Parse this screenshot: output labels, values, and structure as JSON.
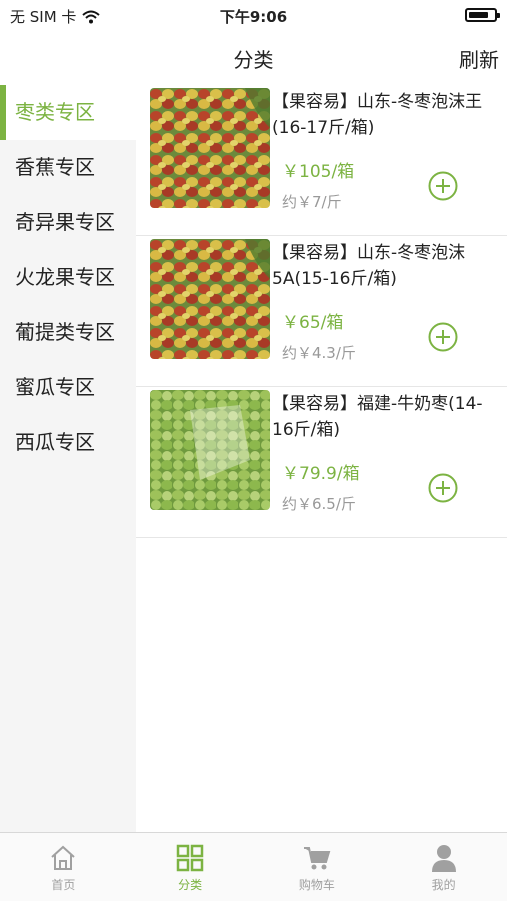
{
  "status_bar": {
    "carrier": "无 SIM 卡",
    "time": "下午9:06",
    "battery_level": 0.8
  },
  "nav": {
    "title": "分类",
    "refresh_label": "刷新"
  },
  "sidebar": {
    "items": [
      {
        "label": "枣类专区",
        "active": true
      },
      {
        "label": "香蕉专区",
        "active": false
      },
      {
        "label": "奇异果专区",
        "active": false
      },
      {
        "label": "火龙果专区",
        "active": false
      },
      {
        "label": "葡提类专区",
        "active": false
      },
      {
        "label": "蜜瓜专区",
        "active": false
      },
      {
        "label": "西瓜专区",
        "active": false
      }
    ]
  },
  "products": [
    {
      "name": "【果容易】山东-冬枣泡沫王(16-17斤/箱)",
      "price": "￥105/箱",
      "unit_price": "约￥7/斤",
      "image": "dates-red-green"
    },
    {
      "name": "【果容易】山东-冬枣泡沫5A(15-16斤/箱)",
      "price": "￥65/箱",
      "unit_price": "约￥4.3/斤",
      "image": "dates-red-green"
    },
    {
      "name": "【果容易】福建-牛奶枣(14-16斤/箱)",
      "price": "￥79.9/箱",
      "unit_price": "约￥6.5/斤",
      "image": "dates-green"
    }
  ],
  "tab_bar": {
    "tabs": [
      {
        "label": "首页",
        "icon": "home-icon",
        "active": false
      },
      {
        "label": "分类",
        "icon": "grid-icon",
        "active": true
      },
      {
        "label": "购物车",
        "icon": "cart-icon",
        "active": false
      },
      {
        "label": "我的",
        "icon": "user-icon",
        "active": false
      }
    ]
  },
  "colors": {
    "accent": "#7cb342",
    "inactive": "#a0a0a0",
    "sidebar_bg": "#f5f5f5"
  }
}
